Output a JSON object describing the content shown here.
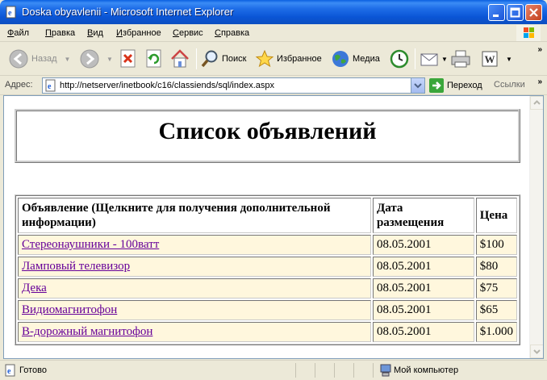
{
  "window": {
    "title": "Doska obyavlenii - Microsoft Internet Explorer"
  },
  "menu": {
    "items": [
      "Файл",
      "Правка",
      "Вид",
      "Избранное",
      "Сервис",
      "Справка"
    ]
  },
  "toolbar": {
    "back_label": "Назад",
    "search_label": "Поиск",
    "favorites_label": "Избранное",
    "media_label": "Медиа"
  },
  "address": {
    "label": "Адрес:",
    "url": "http://netserver/inetbook/c16/classiends/sql/index.aspx",
    "go_label": "Переход",
    "links_label": "Ссылки"
  },
  "page": {
    "title": "Список объявлений",
    "table": {
      "headers": [
        "Объявление (Щелкните для получения дополнительной информации)",
        "Дата размещения",
        "Цена"
      ],
      "rows": [
        {
          "ad": "Стереонаушники - 100ватт",
          "date": "08.05.2001",
          "price": "$100"
        },
        {
          "ad": "Ламповый телевизор",
          "date": "08.05.2001",
          "price": "$80"
        },
        {
          "ad": "Дека",
          "date": "08.05.2001",
          "price": "$75"
        },
        {
          "ad": "Видиомагнитофон",
          "date": "08.05.2001",
          "price": "$65"
        },
        {
          "ad": "В-дорожный магнитофон",
          "date": "08.05.2001",
          "price": "$1.000"
        }
      ]
    }
  },
  "status": {
    "text": "Готово",
    "zone": "Мой компьютер"
  },
  "colors": {
    "titlebar": "#0a55d6",
    "row_bg": "#fff7dd",
    "link": "#660099"
  }
}
